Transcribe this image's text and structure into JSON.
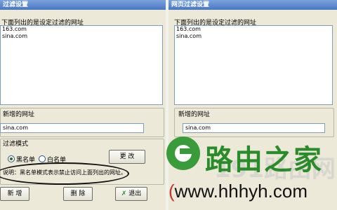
{
  "left": {
    "title": "过滤设置",
    "list_label": "下面列出的是设定过滤的网址",
    "list_items": [
      "163.com",
      "sina.com"
    ],
    "new_url_label": "新增的网址",
    "new_url_value": "sina.com",
    "mode_label": "过滤模式",
    "blacklist_label": "黑名单",
    "whitelist_label": "白名单",
    "mode_selected": "blacklist",
    "modify_button": "更 改",
    "note": "说明：黑名单模式表示禁止访问上面列出的网址。",
    "add_button": "新 增",
    "delete_button": "删 除",
    "exit_button": "退出"
  },
  "right": {
    "title": "网页过滤设置",
    "list_label": "下面列出的是设定过滤的网址",
    "list_items": [
      "163.com",
      "sina.com"
    ],
    "new_url_label": "新增的网址",
    "new_url_value": "sina.com"
  },
  "watermark": {
    "title": "路由之家",
    "url": "www.hhhyh.com",
    "faint": "191路由网"
  },
  "colors": {
    "dialog_bg": "#ece9d8",
    "titlebar": "#4a76c3",
    "watermark_green": "#2a8b2a"
  }
}
